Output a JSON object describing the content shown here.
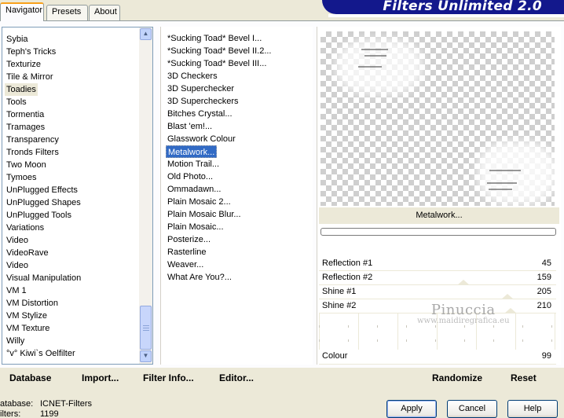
{
  "tabs": [
    "Navigator",
    "Presets",
    "About"
  ],
  "banner": "Filters Unlimited 2.0",
  "categories": [
    "Sybia",
    "Teph's Tricks",
    "Texturize",
    "Tile & Mirror",
    "Toadies",
    "Tools",
    "Tormentia",
    "Tramages",
    "Transparency",
    "Tronds Filters",
    "Two Moon",
    "Tymoes",
    "UnPlugged Effects",
    "UnPlugged Shapes",
    "UnPlugged Tools",
    "Variations",
    "Video",
    "VideoRave",
    "Video",
    "Visual Manipulation",
    "VM 1",
    "VM Distortion",
    "VM Stylize",
    "VM Texture",
    "Willy",
    "°v° Kiwi`s Oelfilter"
  ],
  "selected_category": "Toadies",
  "filters": [
    "*Sucking Toad*  Bevel I...",
    "*Sucking Toad*  Bevel II.2...",
    "*Sucking Toad*  Bevel III...",
    "3D Checkers",
    "3D Superchecker",
    "3D Supercheckers",
    "Bitches Crystal...",
    "Blast 'em!...",
    "Glasswork Colour",
    "Metalwork...",
    "Motion Trail...",
    "Old Photo...",
    "Ommadawn...",
    "Plain Mosaic 2...",
    "Plain Mosaic Blur...",
    "Plain Mosaic...",
    "Posterize...",
    "Rasterline",
    "Weaver...",
    "What Are You?..."
  ],
  "selected_filter": "Metalwork...",
  "filter_title": "Metalwork...",
  "params": [
    {
      "label": "Reflection #1",
      "value": "45"
    },
    {
      "label": "Reflection #2",
      "value": "159"
    },
    {
      "label": "Shine #1",
      "value": "205"
    },
    {
      "label": "Shine #2",
      "value": "210"
    }
  ],
  "colour_param": {
    "label": "Colour",
    "value": "99"
  },
  "watermark": {
    "name": "Pinuccia",
    "url": "www.maidiregrafica.eu"
  },
  "toolbar": {
    "database": "Database",
    "import": "Import...",
    "filter_info": "Filter Info...",
    "editor": "Editor...",
    "randomize": "Randomize",
    "reset": "Reset"
  },
  "status": {
    "database_label": "atabase:",
    "database_value": "ICNET-Filters",
    "filters_label": "ilters:",
    "filters_value": "1199"
  },
  "buttons": {
    "apply": "Apply",
    "cancel": "Cancel",
    "help": "Help"
  },
  "colors": {
    "selection": "#316ac5",
    "banner": "#13188c",
    "dialog_bg": "#ece9d8"
  }
}
